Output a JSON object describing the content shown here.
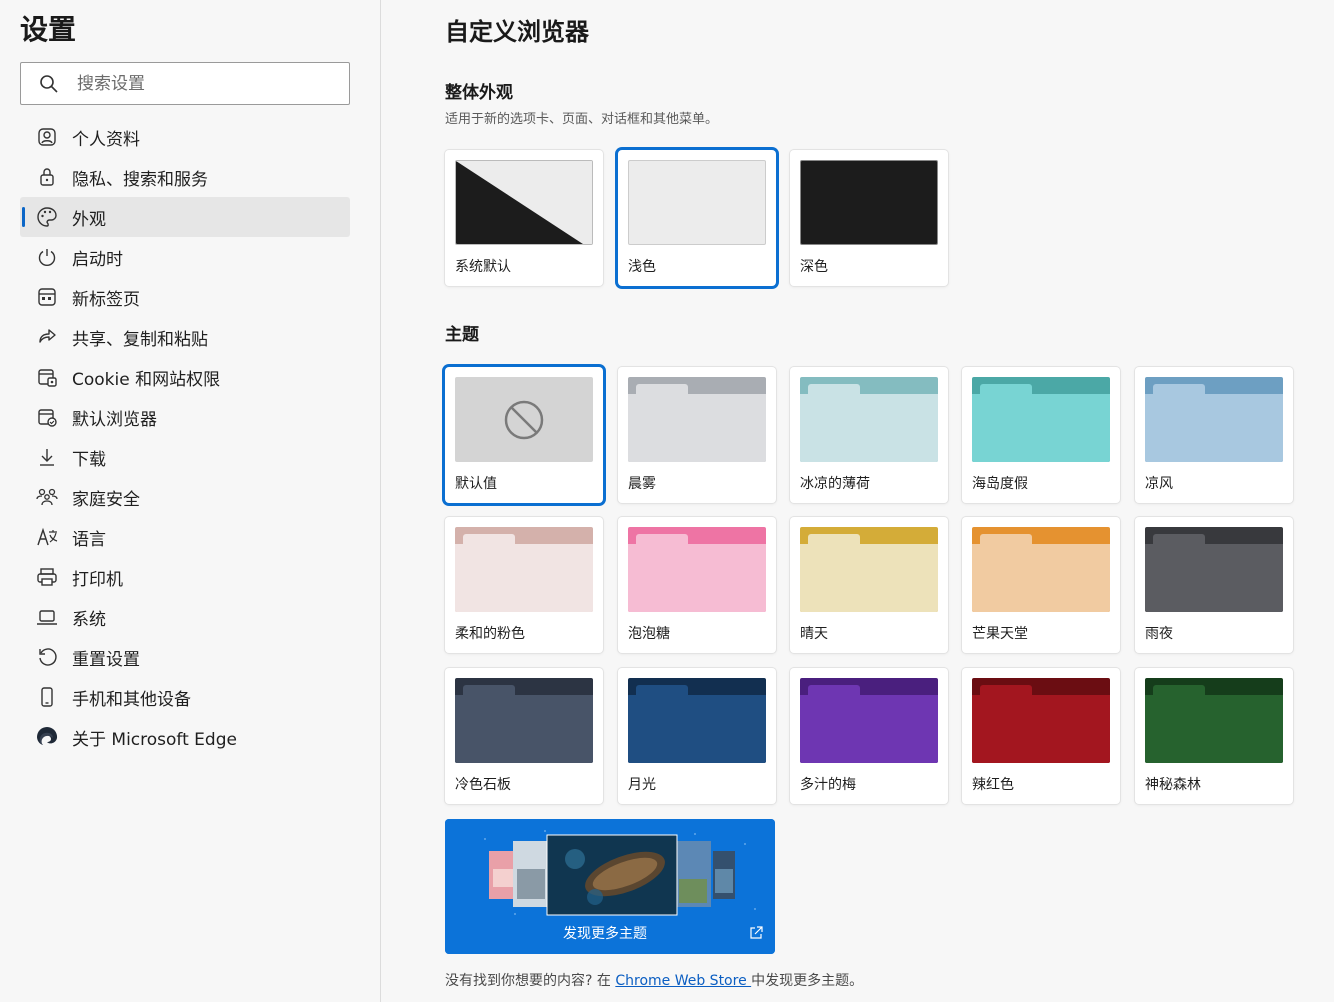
{
  "sidebar": {
    "title": "设置",
    "search_placeholder": "搜索设置",
    "items": [
      {
        "label": "个人资料",
        "icon": "profile-icon"
      },
      {
        "label": "隐私、搜索和服务",
        "icon": "lock-icon"
      },
      {
        "label": "外观",
        "icon": "palette-icon",
        "active": true
      },
      {
        "label": "启动时",
        "icon": "power-icon"
      },
      {
        "label": "新标签页",
        "icon": "new-tab-icon"
      },
      {
        "label": "共享、复制和粘贴",
        "icon": "share-icon"
      },
      {
        "label": "Cookie 和网站权限",
        "icon": "site-permissions-icon"
      },
      {
        "label": "默认浏览器",
        "icon": "default-browser-icon"
      },
      {
        "label": "下载",
        "icon": "download-icon"
      },
      {
        "label": "家庭安全",
        "icon": "family-icon"
      },
      {
        "label": "语言",
        "icon": "language-icon"
      },
      {
        "label": "打印机",
        "icon": "printer-icon"
      },
      {
        "label": "系统",
        "icon": "laptop-icon"
      },
      {
        "label": "重置设置",
        "icon": "reset-icon"
      },
      {
        "label": "手机和其他设备",
        "icon": "phone-icon"
      },
      {
        "label": "关于 Microsoft Edge",
        "icon": "edge-logo-icon"
      }
    ]
  },
  "main": {
    "title": "自定义浏览器",
    "appearance": {
      "title": "整体外观",
      "description": "适用于新的选项卡、页面、对话框和其他菜单。",
      "options": [
        {
          "label": "系统默认"
        },
        {
          "label": "浅色",
          "selected": true
        },
        {
          "label": "深色"
        }
      ]
    },
    "themes": {
      "title": "主题",
      "items": [
        {
          "label": "默认值",
          "selected": true,
          "tab": "#d4d4d4",
          "top": "#d4d4d4",
          "body": "#d4d4d4"
        },
        {
          "label": "晨雾",
          "tab": "#dcdde0",
          "top": "#a9adb3",
          "body": "#dcdde0"
        },
        {
          "label": "冰凉的薄荷",
          "tab": "#c9e2e5",
          "top": "#84bcc0",
          "body": "#c9e2e5"
        },
        {
          "label": "海岛度假",
          "tab": "#78d4d3",
          "top": "#4ba8a6",
          "body": "#78d4d3"
        },
        {
          "label": "凉风",
          "tab": "#a8c8e0",
          "top": "#6d9fc2",
          "body": "#a8c8e0"
        },
        {
          "label": "柔和的粉色",
          "tab": "#f1e4e3",
          "top": "#d4b1ab",
          "body": "#f1e4e3"
        },
        {
          "label": "泡泡糖",
          "tab": "#f6bcd3",
          "top": "#ee74a4",
          "body": "#f6bcd3"
        },
        {
          "label": "晴天",
          "tab": "#ede2ba",
          "top": "#d4ac38",
          "body": "#ede2ba"
        },
        {
          "label": "芒果天堂",
          "tab": "#f1cba1",
          "top": "#e59230",
          "body": "#f1cba1"
        },
        {
          "label": "雨夜",
          "tab": "#5b5c61",
          "top": "#38393d",
          "body": "#5b5c61"
        },
        {
          "label": "冷色石板",
          "tab": "#485468",
          "top": "#2c3443",
          "body": "#485468"
        },
        {
          "label": "月光",
          "tab": "#1f4e82",
          "top": "#122f50",
          "body": "#1f4e82"
        },
        {
          "label": "多汁的梅",
          "tab": "#6e36b2",
          "top": "#4a1f7e",
          "body": "#6e36b2"
        },
        {
          "label": "辣红色",
          "tab": "#a3161f",
          "top": "#6b0d12",
          "body": "#a3161f"
        },
        {
          "label": "神秘森林",
          "tab": "#26622e",
          "top": "#153d1b",
          "body": "#26622e"
        }
      ],
      "store_label": "发现更多主题"
    },
    "footer": {
      "prefix": "没有找到你想要的内容? 在 ",
      "link": "Chrome Web Store ",
      "suffix": "中发现更多主题。"
    }
  },
  "colors": {
    "accent": "#0b6fd1"
  }
}
